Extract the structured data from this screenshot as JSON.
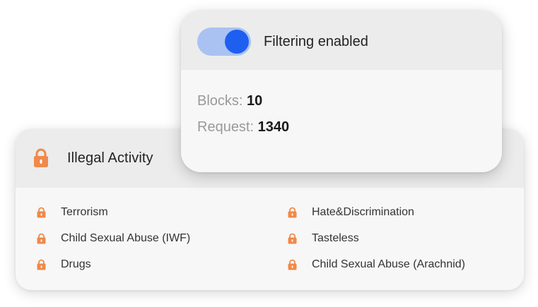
{
  "filter_card": {
    "title": "Filtering enabled",
    "toggle_on": true,
    "blocks_label": "Blocks:",
    "blocks_value": "10",
    "requests_label": "Request:",
    "requests_value": "1340"
  },
  "category_card": {
    "title": "Illegal Activity",
    "icon": "lock-icon",
    "rules_left": [
      {
        "label": "Terrorism",
        "icon": "lock-icon"
      },
      {
        "label": "Child Sexual Abuse (IWF)",
        "icon": "lock-icon"
      },
      {
        "label": "Drugs",
        "icon": "lock-icon"
      }
    ],
    "rules_right": [
      {
        "label": "Hate&Discrimination",
        "icon": "lock-icon"
      },
      {
        "label": "Tasteless",
        "icon": "lock-icon"
      },
      {
        "label": "Child Sexual Abuse (Arachnid)",
        "icon": "lock-icon"
      }
    ]
  },
  "colors": {
    "accent": "#1f5ff0",
    "toggle_track": "#a9c2f2",
    "lock": "#f0894a",
    "header_bg": "#ececec",
    "card_bg": "#f7f7f7"
  }
}
